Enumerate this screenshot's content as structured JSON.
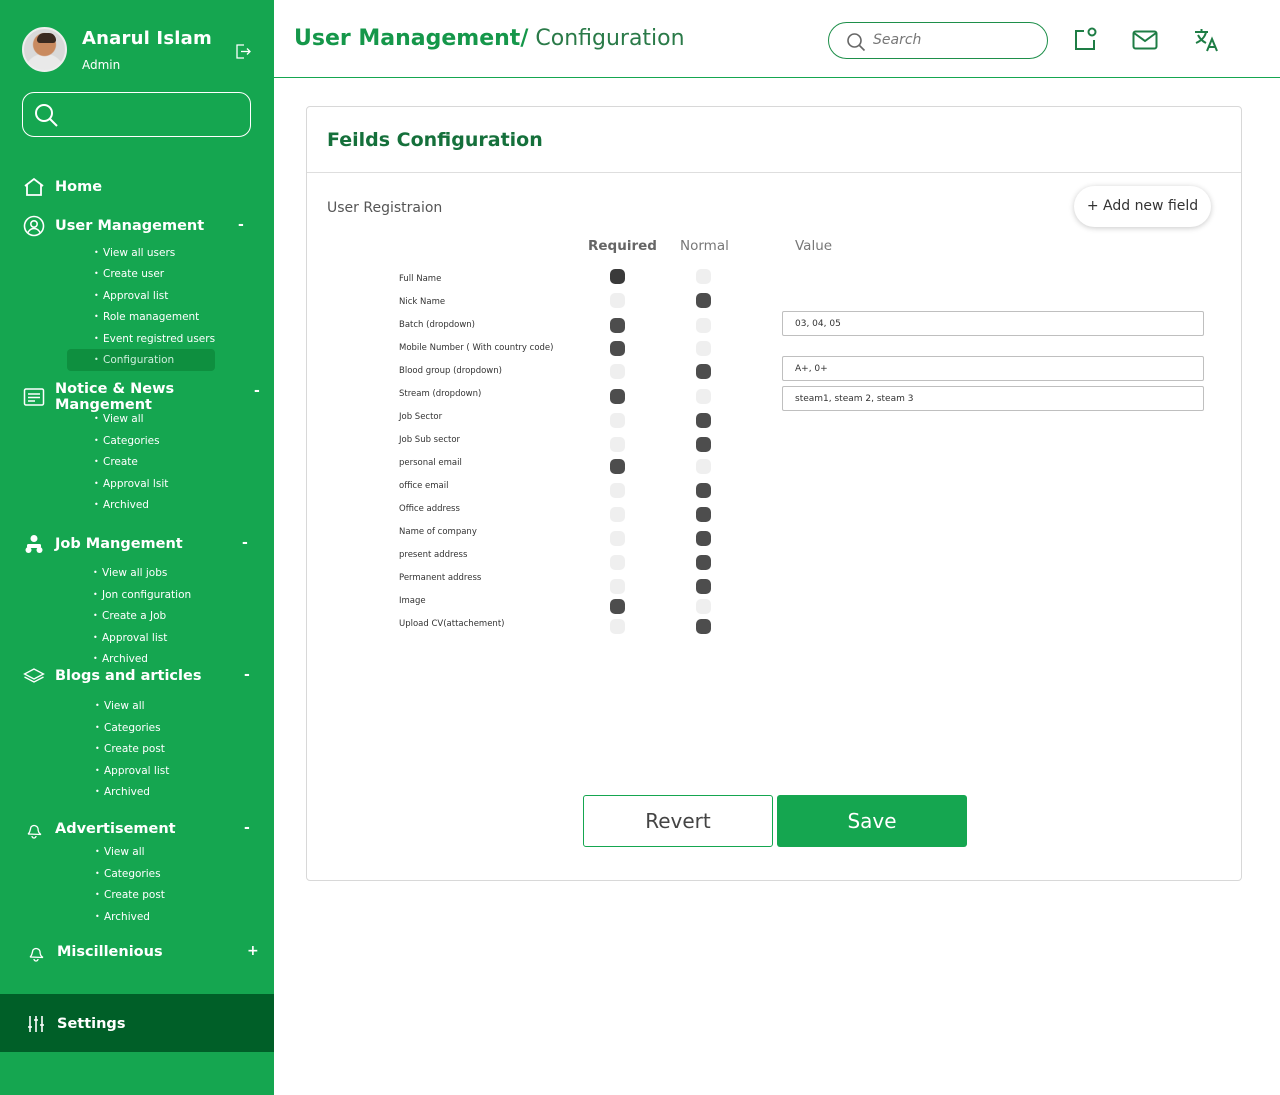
{
  "profile": {
    "name": "Anarul Islam",
    "role": "Admin"
  },
  "sidebar": {
    "home": "Home",
    "sections": [
      {
        "label": "User Management",
        "toggle": "-",
        "items": [
          "View all users",
          "Create user",
          "Approval list",
          "Role management",
          "Event registred users",
          "Configuration"
        ]
      },
      {
        "label": "Notice & News Mangement",
        "toggle": "-",
        "items": [
          "View all",
          "Categories",
          "Create",
          "Approval lsit",
          "Archived"
        ]
      },
      {
        "label": "Job Mangement",
        "toggle": "-",
        "items": [
          "View all jobs",
          "Jon configuration",
          "Create a Job",
          "Approval list",
          "Archived"
        ]
      },
      {
        "label": "Blogs and articles",
        "toggle": "-",
        "items": [
          "View all",
          "Categories",
          "Create post",
          "Approval list",
          "Archived"
        ]
      },
      {
        "label": "Advertisement",
        "toggle": "-",
        "items": [
          "View all",
          "Categories",
          "Create post",
          "Archived"
        ]
      },
      {
        "label": "Miscillenious",
        "toggle": "+",
        "items": []
      }
    ],
    "active_item": "Configuration",
    "settings": "Settings"
  },
  "header": {
    "title_bold": "User Management/",
    "title_normal": " Configuration",
    "search_placeholder": "Search",
    "icons": [
      "notification-icon",
      "mail-icon",
      "translate-icon"
    ]
  },
  "card": {
    "title": "Feilds Configuration",
    "section": "User Registraion",
    "add_button": "+ Add  new field",
    "columns": {
      "required": "Required",
      "normal": "Normal",
      "value": "Value"
    },
    "fields": [
      {
        "label": "Full Name",
        "mode": "required",
        "value": ""
      },
      {
        "label": "Nick Name",
        "mode": "normal",
        "value": ""
      },
      {
        "label": "Batch (dropdown)",
        "mode": "required",
        "value": "03, 04, 05"
      },
      {
        "label": "Mobile Number ( With country code)",
        "mode": "required",
        "value": ""
      },
      {
        "label": "Blood group (dropdown)",
        "mode": "normal",
        "value": "A+, 0+"
      },
      {
        "label": "Stream (dropdown)",
        "mode": "required",
        "value": "steam1, steam 2, steam 3"
      },
      {
        "label": "Job Sector",
        "mode": "normal",
        "value": ""
      },
      {
        "label": "Job Sub sector",
        "mode": "normal",
        "value": ""
      },
      {
        "label": "personal email",
        "mode": "required",
        "value": ""
      },
      {
        "label": "office email",
        "mode": "normal",
        "value": ""
      },
      {
        "label": "Office address",
        "mode": "normal",
        "value": ""
      },
      {
        "label": " Name of company",
        "mode": "normal",
        "value": ""
      },
      {
        "label": "present address",
        "mode": "normal",
        "value": ""
      },
      {
        "label": "Permanent address",
        "mode": "normal",
        "value": ""
      },
      {
        "label": " Image",
        "mode": "required",
        "value": ""
      },
      {
        "label": "Upload CV(attachement)",
        "mode": "normal",
        "value": ""
      }
    ],
    "revert": "Revert",
    "save": "Save"
  },
  "colors": {
    "sidebar": "#15a650",
    "sidebar_dark": "#005f28",
    "accent": "#15974a"
  }
}
